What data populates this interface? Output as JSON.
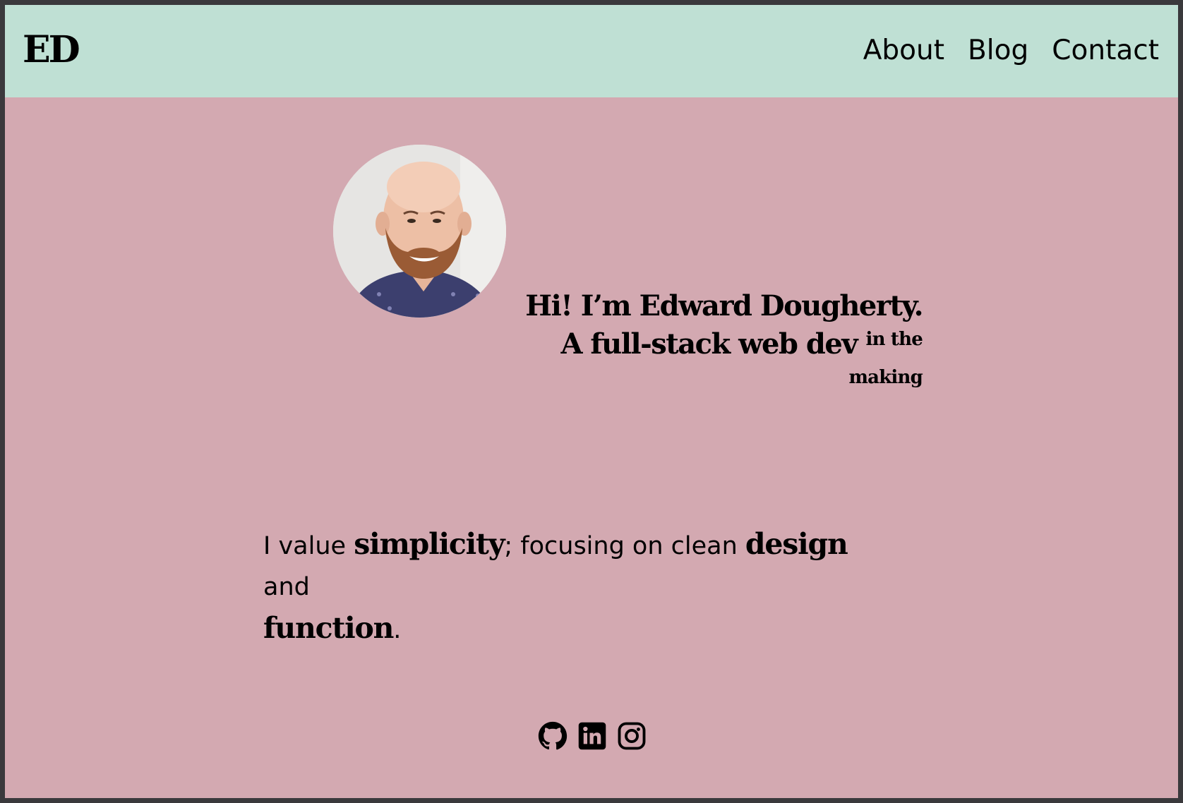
{
  "navbar": {
    "logo": "ED",
    "links": [
      {
        "label": "About"
      },
      {
        "label": "Blog"
      },
      {
        "label": "Contact"
      }
    ]
  },
  "hero": {
    "line1": "Hi! I’m Edward Dougherty.",
    "line2": "A full-stack web dev",
    "line2_sup": "in the making"
  },
  "values": {
    "part1": "I value ",
    "emph1": "simplicity",
    "part2": "; focusing on clean ",
    "emph2": "design",
    "part3": " and",
    "emph3": "function",
    "part4": "."
  },
  "socials": [
    {
      "icon": "github-icon"
    },
    {
      "icon": "linkedin-icon"
    },
    {
      "icon": "instagram-icon"
    }
  ],
  "colors": {
    "page_background": "#d3a9b1",
    "navbar_background": "#bfe0d4",
    "text": "#000000"
  }
}
